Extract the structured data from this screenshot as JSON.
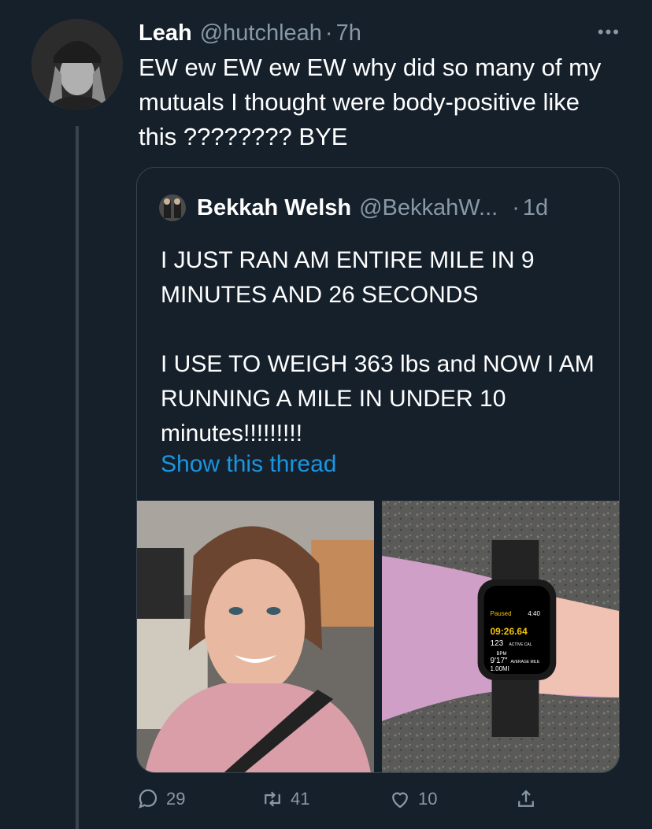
{
  "tweet": {
    "author_name": "Leah",
    "author_handle": "@hutchleah",
    "separator": "·",
    "time": "7h",
    "more_icon": "more-horizontal-icon",
    "text": "EW ew EW ew EW why did so many of my mutuals I thought were body-positive like this ???????? BYE"
  },
  "quote": {
    "author_name": "Bekkah Welsh",
    "author_handle": "@BekkahW...",
    "separator": "·",
    "time": "1d",
    "paragraphs": [
      "I JUST RAN AM ENTIRE MILE IN 9 MINUTES AND 26 SECONDS",
      "I USE TO WEIGH 363 lbs and NOW I AM RUNNING A MILE IN UNDER 10 minutes!!!!!!!!!"
    ],
    "show_thread": "Show this thread",
    "watch": {
      "status": "Paused",
      "clock": "4:40",
      "elapsed": "09:26.64",
      "calories": "123",
      "calories_unit": "ACTIVE CAL",
      "bpm_label": "BPM",
      "pace": "9'17\"",
      "pace_label": "AVERAGE MILE",
      "distance": "1.00MI"
    }
  },
  "actions": {
    "reply_count": "29",
    "retweet_count": "41",
    "like_count": "10",
    "icons": [
      "reply-icon",
      "retweet-icon",
      "like-icon",
      "share-icon"
    ]
  },
  "colors": {
    "background": "#15202b",
    "border": "#38444d",
    "secondary_text": "#8899a6",
    "link": "#1b95e0"
  }
}
